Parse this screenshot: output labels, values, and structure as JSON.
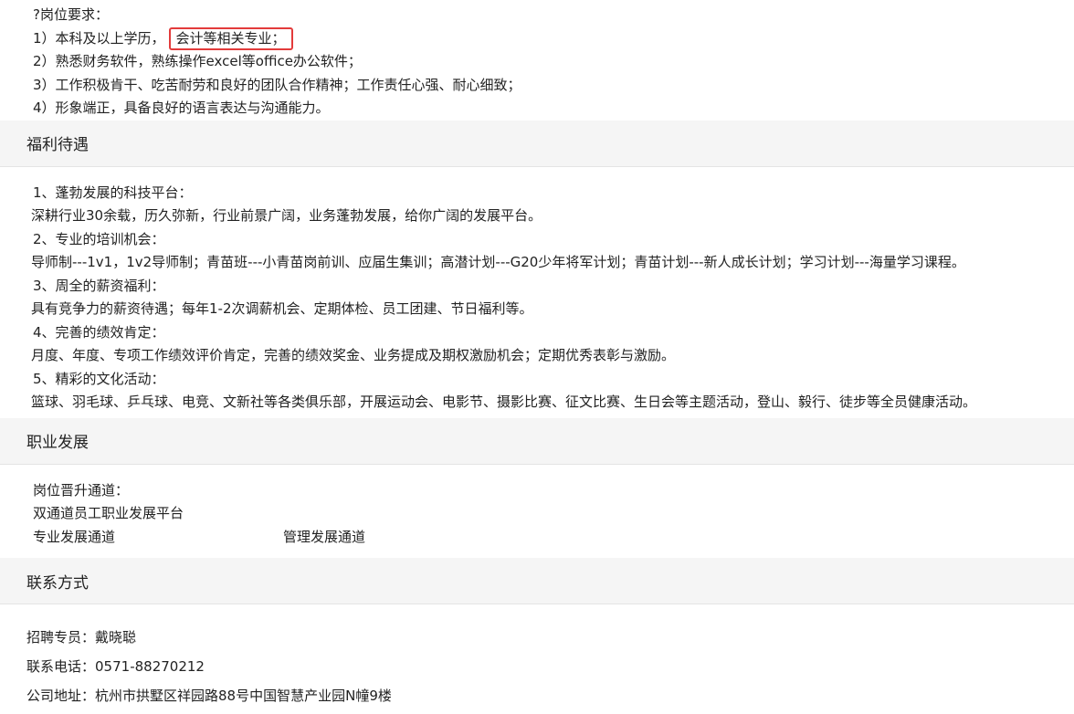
{
  "requirements": {
    "heading": "?岗位要求：",
    "item1_prefix": "1）本科及以上学历，",
    "item1_highlight": "会计等相关专业；",
    "item2": "2）熟悉财务软件，熟练操作excel等office办公软件；",
    "item3": "3）工作积极肯干、吃苦耐劳和良好的团队合作精神；工作责任心强、耐心细致；",
    "item4": "4）形象端正，具备良好的语言表达与沟通能力。"
  },
  "benefits": {
    "title": "福利待遇",
    "lines": [
      "1、蓬勃发展的科技平台：",
      "深耕行业30余载，历久弥新，行业前景广阔，业务蓬勃发展，给你广阔的发展平台。",
      "2、专业的培训机会：",
      "导师制---1v1，1v2导师制；青苗班---小青苗岗前训、应届生集训；高潜计划---G20少年将军计划；青苗计划---新人成长计划；学习计划---海量学习课程。",
      "3、周全的薪资福利：",
      "具有竞争力的薪资待遇；每年1-2次调薪机会、定期体检、员工团建、节日福利等。",
      "4、完善的绩效肯定：",
      "月度、年度、专项工作绩效评价肯定，完善的绩效奖金、业务提成及期权激励机会；定期优秀表彰与激励。",
      "5、精彩的文化活动：",
      "篮球、羽毛球、乒乓球、电竞、文新社等各类俱乐部，开展运动会、电影节、摄影比赛、征文比赛、生日会等主题活动，登山、毅行、徒步等全员健康活动。"
    ]
  },
  "career": {
    "title": "职业发展",
    "line1": "岗位晋升通道：",
    "line2": "双通道员工职业发展平台",
    "track_professional": "专业发展通道",
    "track_management": "管理发展通道"
  },
  "contact": {
    "title": "联系方式",
    "recruiter_label": "招聘专员：",
    "recruiter_name": "戴晓聪",
    "phone_label": "联系电话：",
    "phone": "0571-88270212",
    "address_label": "公司地址：",
    "address": "杭州市拱墅区祥园路88号中国智慧产业园N幢9楼"
  },
  "colors": {
    "highlight_border": "#e33b3b",
    "section_bg": "#f5f5f5"
  }
}
